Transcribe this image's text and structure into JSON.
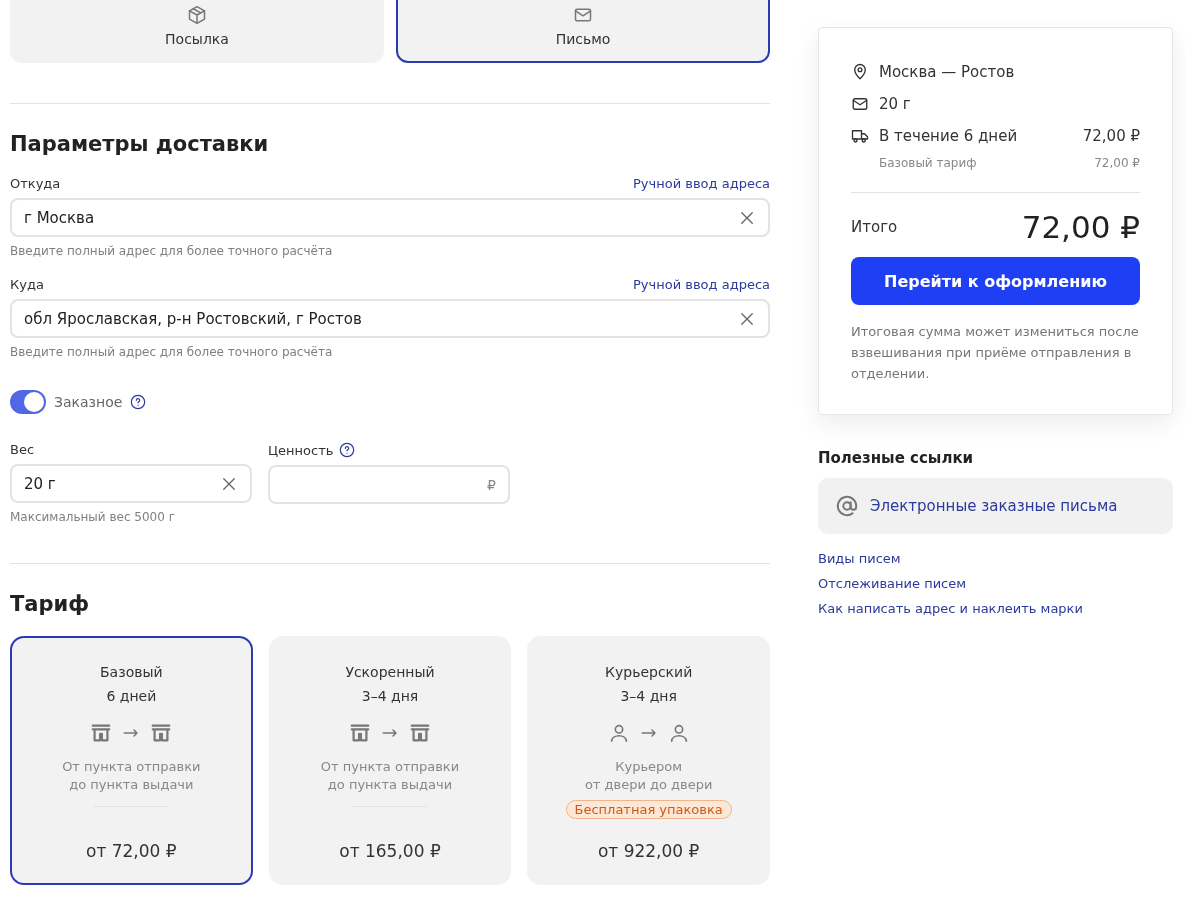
{
  "shipment_types": [
    {
      "kind": "parcel",
      "label": "Посылка",
      "selected": false
    },
    {
      "kind": "letter",
      "label": "Письмо",
      "selected": true
    }
  ],
  "delivery": {
    "title": "Параметры доставки",
    "fields": [
      {
        "label": "Откуда",
        "link": "Ручной ввод адреса",
        "value": "г Москва",
        "hint": "Введите полный адрес для более точного расчёта"
      },
      {
        "label": "Куда",
        "link": "Ручной ввод адреса",
        "value": "обл Ярославская, р-н Ростовский, г Ростов",
        "hint": "Введите полный адрес для более точного расчёта"
      }
    ],
    "registered": {
      "label": "Заказное",
      "on": true
    },
    "weight": {
      "label": "Вес",
      "value": "20 г",
      "hint": "Максимальный вес 5000 г"
    },
    "value_field": {
      "label": "Ценность",
      "currency": "₽"
    }
  },
  "tariff": {
    "title": "Тариф",
    "options": [
      {
        "kind": "pickup",
        "name": "Базовый",
        "duration": "6 дней",
        "description": [
          "От пункта отправки",
          "до пункта выдачи"
        ],
        "price": "от 72,00 ₽",
        "selected": true
      },
      {
        "kind": "pickup",
        "name": "Ускоренный",
        "duration": "3–4 дня",
        "description": [
          "От пункта отправки",
          "до пункта выдачи"
        ],
        "price": "от 165,00 ₽",
        "selected": false
      },
      {
        "kind": "courier",
        "name": "Курьерский",
        "duration": "3–4 дня",
        "description": [
          "Курьером",
          "от двери до двери"
        ],
        "badge": "Бесплатная упаковка",
        "price": "от 922,00 ₽",
        "selected": false
      }
    ]
  },
  "summary": {
    "route": "Москва — Ростов",
    "weight": "20 г",
    "delivery": "В течение 6 дней",
    "delivery_price": "72,00 ₽",
    "tariff_name": "Базовый тариф",
    "tariff_price": "72,00 ₽",
    "total_label": "Итого",
    "total": "72,00 ₽",
    "button": "Перейти к оформлению",
    "note": "Итоговая сумма может измениться после взвешивания при приёме отправления в отделении."
  },
  "useful_links": {
    "title": "Полезные ссылки",
    "featured": "Электронные заказные письма",
    "links": [
      "Виды писем",
      "Отслеживание писем",
      "Как написать адрес и наклеить марки"
    ]
  }
}
